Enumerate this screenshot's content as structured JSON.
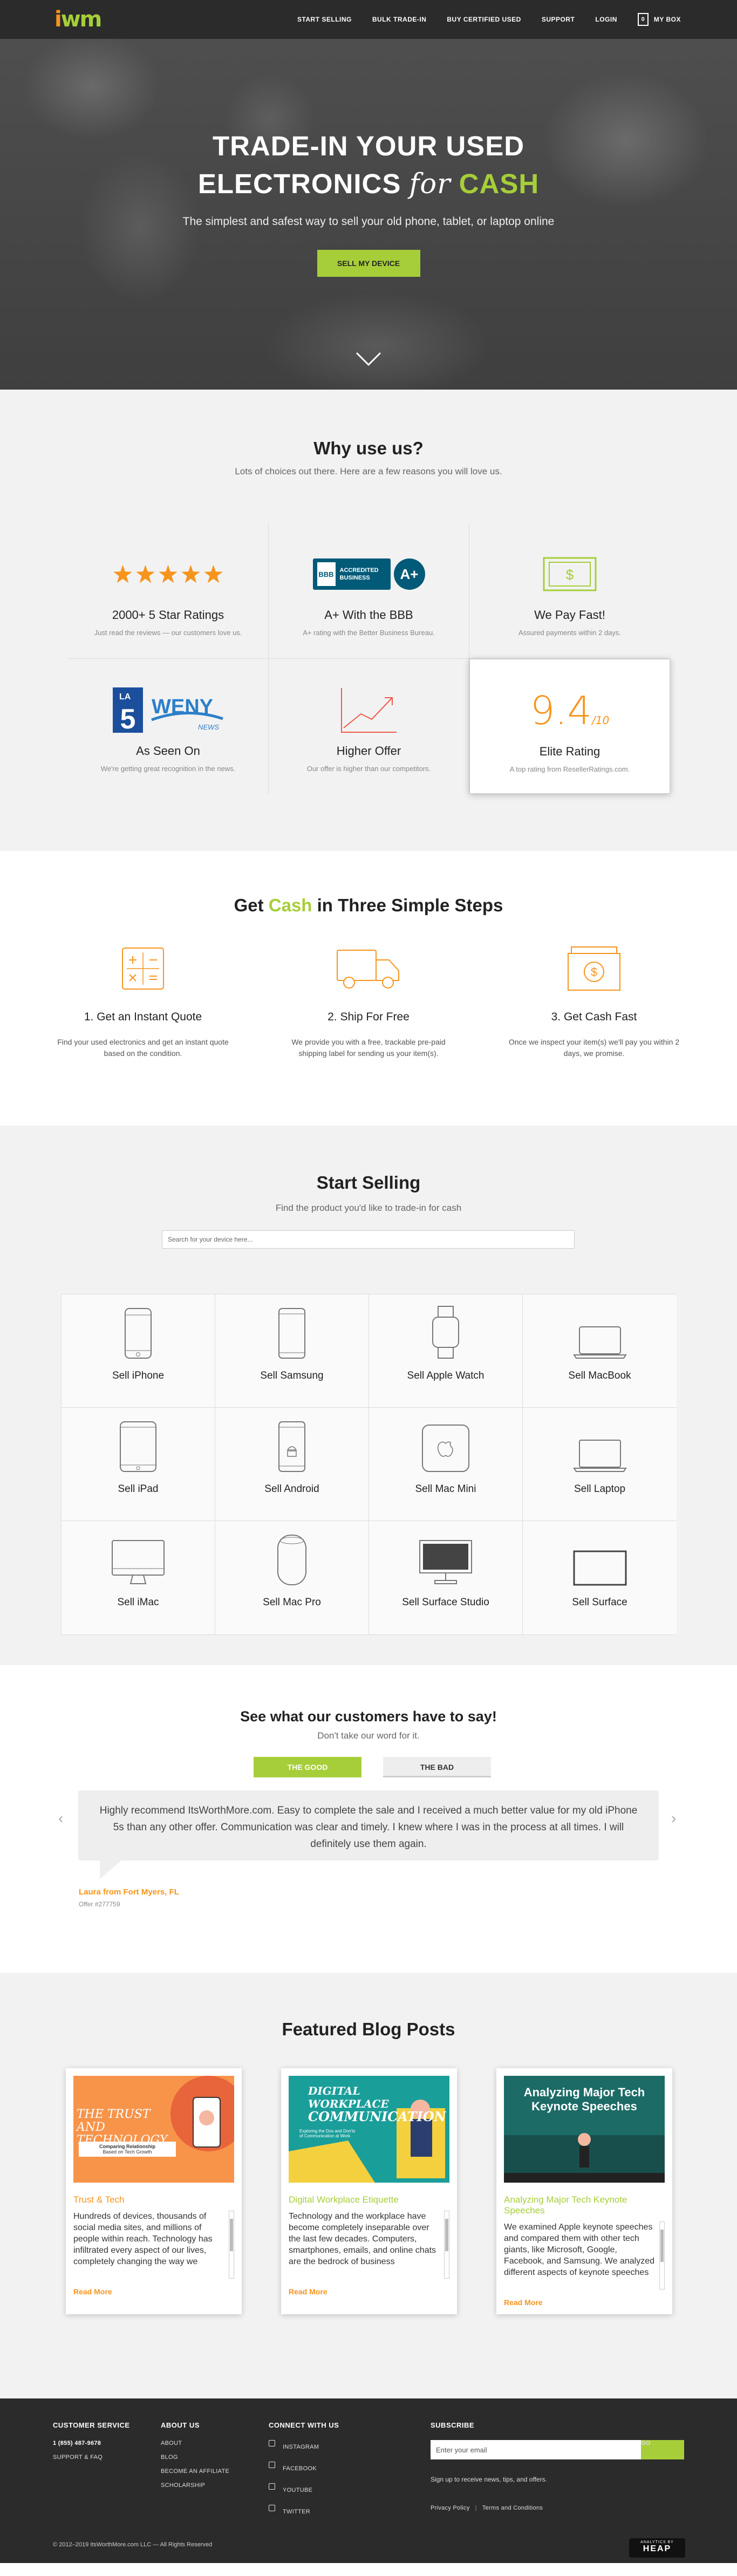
{
  "colors": {
    "accent_green": "#a6ce39",
    "accent_orange": "#f7941d",
    "dark": "#2b2b2b"
  },
  "nav": {
    "logo_i": "i",
    "logo_wm": "wm",
    "links": [
      "START SELLING",
      "BULK TRADE-IN",
      "BUY CERTIFIED USED",
      "SUPPORT",
      "LOGIN"
    ],
    "box_count": "0",
    "box_label": "MY BOX"
  },
  "hero": {
    "title_line1": "TRADE-IN YOUR USED",
    "title_line2_a": "ELECTRONICS",
    "title_line2_for": "for",
    "title_line2_cash": "CASH",
    "subtitle": "The simplest and safest way to sell your old phone, tablet, or laptop online",
    "cta": "SELL MY DEVICE"
  },
  "why": {
    "title": "Why use us?",
    "subtitle": "Lots of choices out there. Here are a few reasons you will love us.",
    "items": [
      {
        "title": "2000+ 5 Star Ratings",
        "desc": "Just read the reviews — our customers love us.",
        "icon": "five-stars"
      },
      {
        "title": "A+ With the BBB",
        "desc": "A+ rating with the Better Business Bureau.",
        "icon": "bbb-badge"
      },
      {
        "title": "We Pay Fast!",
        "desc": "Assured payments within 2 days.",
        "icon": "dollar-bill-icon"
      },
      {
        "title": "As Seen On",
        "desc": "We're getting great recognition in the news.",
        "icon": "news-logos"
      },
      {
        "title": "Higher Offer",
        "desc": "Our offer is higher than our competitors.",
        "icon": "trend-up-icon"
      },
      {
        "title": "Elite Rating",
        "desc": "A top rating from ResellerRatings.com.",
        "icon": "elite-score"
      }
    ],
    "bbb_line1": "ACCREDITED",
    "bbb_line2": "BUSINESS",
    "bbb_logo": "BBB",
    "bbb_grade": "A+",
    "news_ch5": "5",
    "news_weny": "WENY",
    "news_weny_sub": "NEWS",
    "news_la": "LA",
    "elite_score": "9.4",
    "elite_unit": "/10"
  },
  "steps": {
    "title_a": "Get",
    "title_cash": "Cash",
    "title_b": "in Three Simple Steps",
    "items": [
      {
        "title": "1. Get an Instant Quote",
        "desc": "Find your used electronics and get an instant quote based on the condition.",
        "icon": "calculator-icon"
      },
      {
        "title": "2. Ship For Free",
        "desc": "We provide you with a free, trackable pre-paid shipping label for sending us your item(s).",
        "icon": "truck-icon"
      },
      {
        "title": "3. Get Cash Fast",
        "desc": "Once we inspect your item(s) we'll pay you within 2 days, we promise.",
        "icon": "cash-icon"
      }
    ]
  },
  "sell": {
    "title": "Start Selling",
    "subtitle": "Find the product you'd like to trade-in for cash",
    "search_placeholder": "Search for your device here...",
    "products": [
      {
        "label": "Sell iPhone",
        "icon": "iphone-icon"
      },
      {
        "label": "Sell Samsung",
        "icon": "samsung-phone-icon"
      },
      {
        "label": "Sell Apple Watch",
        "icon": "apple-watch-icon"
      },
      {
        "label": "Sell MacBook",
        "icon": "macbook-icon"
      },
      {
        "label": "Sell iPad",
        "icon": "ipad-icon"
      },
      {
        "label": "Sell Android",
        "icon": "android-phone-icon"
      },
      {
        "label": "Sell Mac Mini",
        "icon": "mac-mini-icon"
      },
      {
        "label": "Sell Laptop",
        "icon": "laptop-icon"
      },
      {
        "label": "Sell iMac",
        "icon": "imac-icon"
      },
      {
        "label": "Sell Mac Pro",
        "icon": "mac-pro-icon"
      },
      {
        "label": "Sell Surface Studio",
        "icon": "surface-studio-icon"
      },
      {
        "label": "Sell Surface",
        "icon": "surface-icon"
      }
    ]
  },
  "testimonials": {
    "title": "See what our customers have to say!",
    "subtitle": "Don't take our word for it.",
    "tab_good": "THE GOOD",
    "tab_bad": "THE BAD",
    "quote": "Highly recommend ItsWorthMore.com. Easy to complete the sale and I received a much better value for my old iPhone 5s than any other offer. Communication was clear and timely. I knew where I was in the process at all times. I will definitely use them again.",
    "author": "Laura from Fort Myers, FL",
    "offer": "Offer #277759",
    "arrow_prev": "‹",
    "arrow_next": "›"
  },
  "blog": {
    "title": "Featured Blog Posts",
    "read_more": "Read More",
    "posts": [
      {
        "title": "Trust & Tech",
        "image_lines": [
          "THE TRUST",
          "AND TECHNOLOGY",
          "Comparing Relationship",
          "Based on Tech Growth"
        ],
        "excerpt": "Hundreds of devices, thousands of social media sites, and millions of people within reach. Technology has infiltrated every aspect of our lives, completely changing the way we"
      },
      {
        "title": "Digital Workplace Etiquette",
        "image_lines": [
          "DIGITAL",
          "WORKPLACE",
          "COMMUNICATION",
          "Exploring the Dos and Don'ts",
          "of Communication at Work"
        ],
        "excerpt": "Technology and the workplace have become completely inseparable over the last few decades. Computers, smartphones, emails, and online chats are the bedrock of business"
      },
      {
        "title": "Analyzing Major Tech Keynote Speeches",
        "image_lines": [
          "Analyzing Major Tech",
          "Keynote Speeches"
        ],
        "excerpt": "We examined Apple keynote speeches and compared them with other tech giants, like Microsoft, Google, Facebook, and Samsung. We analyzed different aspects of keynote speeches"
      }
    ]
  },
  "footer": {
    "cs_title": "CUSTOMER SERVICE",
    "cs_phone": "1 (855) 487-9678",
    "cs_support": "SUPPORT & FAQ",
    "about_title": "ABOUT US",
    "about_links": [
      "ABOUT",
      "BLOG",
      "BECOME AN AFFILIATE",
      "SCHOLARSHIP"
    ],
    "connect_title": "CONNECT WITH US",
    "social": [
      "INSTAGRAM",
      "FACEBOOK",
      "YOUTUBE",
      "TWITTER"
    ],
    "subscribe_title": "SUBSCRIBE",
    "email_placeholder": "Enter your email",
    "go": "GO",
    "sub_note": "Sign up to receive news, tips, and offers.",
    "privacy": "Privacy Policy",
    "sep": "|",
    "terms": "Terms and Conditions",
    "copyright": "© 2012–2019 ItsWorthMore.com LLC — All Rights Reserved",
    "heap_label": "ANALYTICS BY",
    "heap_name": "HEAP"
  }
}
